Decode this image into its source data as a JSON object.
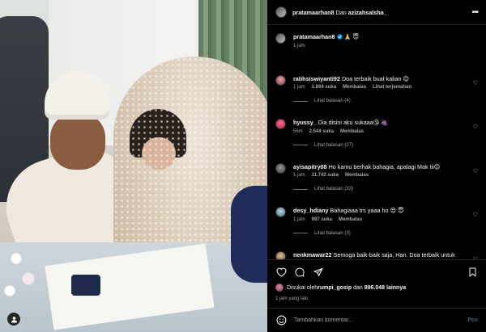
{
  "header": {
    "author": "pratamaarhan8",
    "joiner": "Dan",
    "coauthor": "azizahsalsha_",
    "more_icon": "more-horizontal-icon"
  },
  "caption": {
    "user": "pratamaarhan8",
    "verified_icon": "verified-badge-icon",
    "text": "🙏 😇",
    "time": "1 jam"
  },
  "comments": [
    {
      "user": "ratihsiswiyanti92",
      "text": "Doa terbaik buat kalian 😊",
      "time": "1 jam",
      "likes": "1.894 suka",
      "reply": "Membalas",
      "translate": "Lihat terjemahan",
      "view_replies": "Lihat balasan (4)"
    },
    {
      "user": "hyussy_",
      "text": "Dia disini aku sukaaa😘 🍇",
      "time": "56m",
      "likes": "2.544 suka",
      "reply": "Membalas",
      "translate": "",
      "view_replies": "Lihat balasan (27)"
    },
    {
      "user": "ayisapitry08",
      "text": "Ho kamu berhak bahagia, apalagi Mak tii😊",
      "time": "1 jam",
      "likes": "11.742 suka",
      "reply": "Membalas",
      "translate": "",
      "view_replies": "Lihat balasan (33)"
    },
    {
      "user": "desy_hdiany",
      "text": "Bahagiaaa trs yaaa ho 😍 😇",
      "time": "1 jam",
      "likes": "997 suka",
      "reply": "Membalas",
      "translate": "",
      "view_replies": "Lihat balasan (3)"
    },
    {
      "user": "nenkmawar22",
      "text": "Semoga baik-baik saja, Han. Doa terbaik untuk rumah tangga kalian, ya Allah. Semoga ada jalan keluar yang terbaik 👏👏👏👏👏👏👏👏👏",
      "time": "",
      "likes": "",
      "reply": "",
      "translate": "",
      "view_replies": ""
    }
  ],
  "actions": {
    "like_icon": "heart-icon",
    "comment_icon": "comment-icon",
    "share_icon": "send-icon",
    "save_icon": "bookmark-icon"
  },
  "likes": {
    "prefix": "Disukai oleh",
    "user": "rumpi_gosip",
    "middle": "dan",
    "count": "896.048 lainnya"
  },
  "timestamp": "1 jam yang lalu",
  "add_comment": {
    "placeholder": "Tambahkan komentar...",
    "post_label": "Pos"
  }
}
